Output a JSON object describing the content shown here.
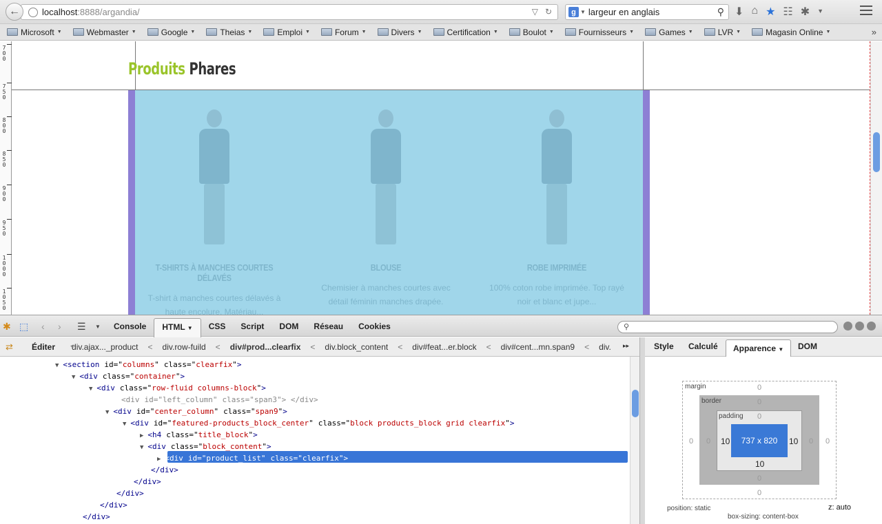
{
  "browser": {
    "url_host": "localhost",
    "url_rest": ":8888/argandia/",
    "search_value": "largeur en anglais"
  },
  "bookmarks": [
    "Microsoft",
    "Webmaster",
    "Google",
    "Theias",
    "Emploi",
    "Forum",
    "Divers",
    "Certification",
    "Boulot",
    "Fournisseurs",
    "Games",
    "LVR",
    "Magasin Online"
  ],
  "ruler": [
    "7\n0\n0",
    "7\n5\n0",
    "8\n0\n0",
    "8\n5\n0",
    "9\n0\n0",
    "9\n5\n0",
    "1\n0\n0\n0",
    "1\n0\n5\n0"
  ],
  "page": {
    "title_green": "Produits",
    "title_dark": "Phares",
    "products": [
      {
        "name": "T-SHIRTS À MANCHES COURTES DÉLAVÉS",
        "desc": "T-shirt à manches courtes délavés à haute encolure. Matériau..."
      },
      {
        "name": "BLOUSE",
        "desc": "Chemisier à manches courtes avec détail féminin manches drapée."
      },
      {
        "name": "ROBE IMPRIMÉE",
        "desc": "100% coton robe imprimée. Top rayé noir et blanc et jupe..."
      }
    ]
  },
  "firebug": {
    "tabs": [
      "Console",
      "HTML",
      "CSS",
      "Script",
      "DOM",
      "Réseau",
      "Cookies"
    ],
    "active_tab": "HTML",
    "edit_label": "Éditer",
    "breadcrumb": [
      "div.ajax..._product",
      "div.row-fuild",
      "div#prod...clearfix",
      "div.block_content",
      "div#feat...er.block",
      "div#cent...mn.span9",
      "div."
    ],
    "side_tabs": [
      "Style",
      "Calculé",
      "Apparence",
      "DOM"
    ],
    "active_side_tab": "Apparence",
    "boxmodel": {
      "margin_label": "margin",
      "border_label": "border",
      "padding_label": "padding",
      "content": "737 x 820",
      "margin": {
        "top": "0",
        "right": "0",
        "bottom": "0",
        "left": "0"
      },
      "border": {
        "top": "0",
        "right": "0",
        "bottom": "0",
        "left": "0"
      },
      "padding": {
        "top": "0",
        "right": "10",
        "bottom": "10",
        "left": "10"
      },
      "position": "position: static",
      "z": "z: auto",
      "box_sizing": "box-sizing: content-box"
    },
    "code": [
      {
        "indent": 80,
        "tw": "▼",
        "tag": "section",
        "attrs": [
          [
            "id",
            "columns"
          ],
          [
            "class",
            "clearfix"
          ]
        ],
        "close": false
      },
      {
        "indent": 104,
        "tw": "▼",
        "tag": "div",
        "attrs": [
          [
            "class",
            "container"
          ]
        ],
        "close": false
      },
      {
        "indent": 129,
        "tw": "▼",
        "tag": "div",
        "attrs": [
          [
            "class",
            "row-fluid columns-block"
          ]
        ],
        "close": false
      },
      {
        "indent": 170,
        "tw": "",
        "tag": "div",
        "attrs": [
          [
            "id",
            "left_column"
          ],
          [
            "class",
            "span3"
          ]
        ],
        "close": true,
        "dim": true
      },
      {
        "indent": 153,
        "tw": "▼",
        "tag": "div",
        "attrs": [
          [
            "id",
            "center_column"
          ],
          [
            "class",
            "span9"
          ]
        ],
        "close": false
      },
      {
        "indent": 178,
        "tw": "▼",
        "tag": "div",
        "attrs": [
          [
            "id",
            "featured-products_block_center"
          ],
          [
            "class",
            "block products_block grid clearfix"
          ]
        ],
        "close": false
      },
      {
        "indent": 203,
        "tw": "▶",
        "tag": "h4",
        "attrs": [
          [
            "class",
            "title_block"
          ]
        ],
        "close": false
      },
      {
        "indent": 203,
        "tw": "▼",
        "tag": "div",
        "attrs": [
          [
            "class",
            "block_content"
          ]
        ],
        "close": false
      },
      {
        "indent": 228,
        "tw": "▶",
        "tag": "div",
        "attrs": [
          [
            "id",
            "product_list"
          ],
          [
            "class",
            "clearfix"
          ]
        ],
        "close": false,
        "selected": true
      },
      {
        "indent": 219,
        "closing": "</div>"
      },
      {
        "indent": 194,
        "closing": "</div>"
      },
      {
        "indent": 169,
        "closing": "</div>"
      },
      {
        "indent": 145,
        "closing": "</div>"
      },
      {
        "indent": 120,
        "closing": "</div>"
      }
    ]
  }
}
